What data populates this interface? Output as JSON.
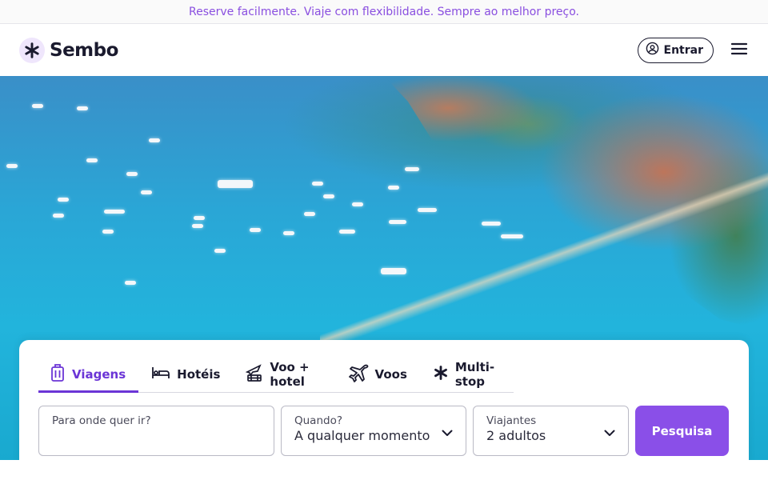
{
  "promo": {
    "text": "Reserve facilmente. Viaje com flexibilidade. Sempre ao melhor preço."
  },
  "header": {
    "brand": "Sembo",
    "signin_label": "Entrar"
  },
  "search": {
    "tabs": [
      {
        "label": "Viagens",
        "icon": "suitcase-icon",
        "active": true
      },
      {
        "label": "Hotéis",
        "icon": "bed-icon",
        "active": false
      },
      {
        "label": "Voo + hotel",
        "icon": "plane-pool-icon",
        "active": false
      },
      {
        "label": "Voos",
        "icon": "plane-icon",
        "active": false
      },
      {
        "label": "Multi-stop",
        "icon": "sembo-star-icon",
        "active": false
      }
    ],
    "destination": {
      "label": "Para onde quer ir?",
      "value": ""
    },
    "when": {
      "label": "Quando?",
      "value": "A qualquer momento"
    },
    "travelers": {
      "label": "Viajantes",
      "value": "2 adultos"
    },
    "button_label": "Pesquisa"
  },
  "colors": {
    "accent": "#6b35d6",
    "button": "#8a4fe8",
    "promo_text": "#8a4fe0"
  }
}
